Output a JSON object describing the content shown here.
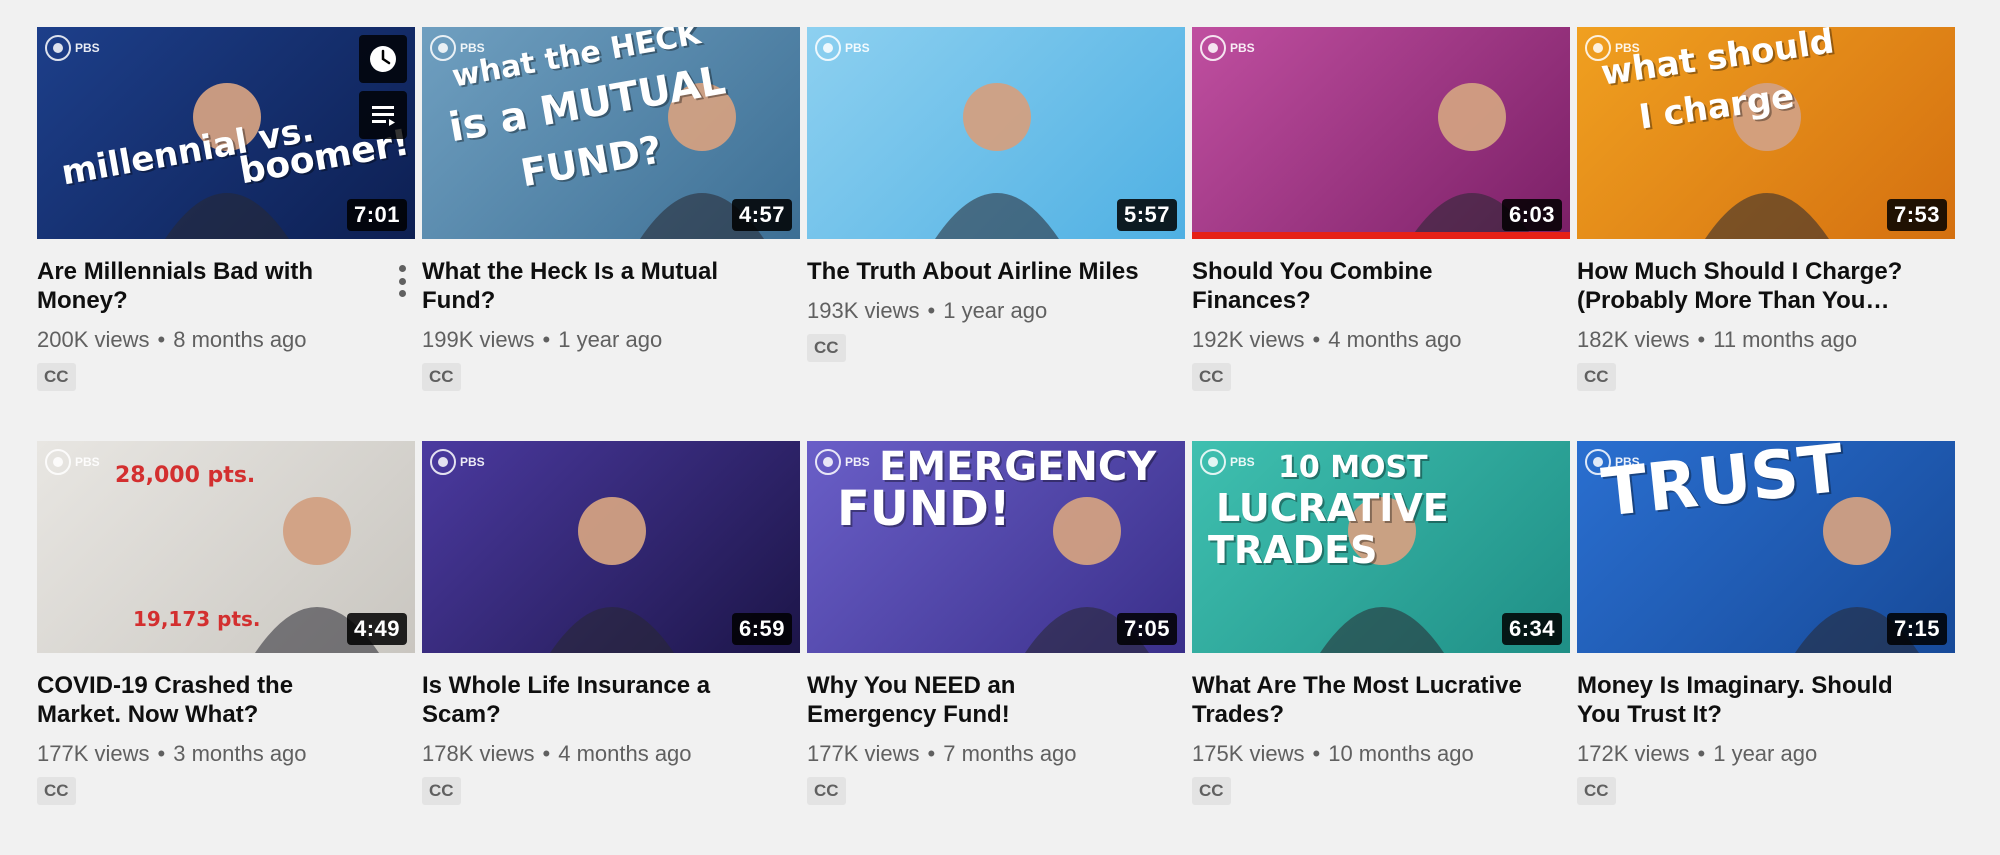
{
  "videos": [
    {
      "title": "Are Millennials Bad with Money?",
      "views": "200K views",
      "age": "8 months ago",
      "duration": "7:01",
      "cc": "CC",
      "thumb_text": [
        "millennial vs.",
        "boomer!"
      ],
      "bg": [
        "#1d3f8a",
        "#0d1f52"
      ],
      "show_menu": true,
      "progress": 0
    },
    {
      "title": "What the Heck Is a Mutual Fund?",
      "views": "199K views",
      "age": "1 year ago",
      "duration": "4:57",
      "cc": "CC",
      "thumb_text": [
        "what the HECK",
        "is a MUTUAL",
        "FUND?"
      ],
      "bg": [
        "#6f9fc0",
        "#3d6f94"
      ],
      "progress": 0
    },
    {
      "title": "The Truth About Airline Miles",
      "views": "193K views",
      "age": "1 year ago",
      "duration": "5:57",
      "cc": "CC",
      "thumb_text": [],
      "bg": [
        "#8dd0f0",
        "#4fb0e3"
      ],
      "progress": 0
    },
    {
      "title": "Should You Combine Finances?",
      "views": "192K views",
      "age": "4 months ago",
      "duration": "6:03",
      "cc": "CC",
      "thumb_text": [],
      "bg": [
        "#c04fa0",
        "#7a1f66"
      ],
      "progress": 1.0
    },
    {
      "title": "How Much Should I Charge? (Probably More Than You…",
      "views": "182K views",
      "age": "11 months ago",
      "duration": "7:53",
      "cc": "CC",
      "thumb_text": [
        "what should",
        "I charge"
      ],
      "bg": [
        "#f0a020",
        "#d47010"
      ],
      "progress": 0
    },
    {
      "title": "COVID-19 Crashed the Market. Now What?",
      "views": "177K views",
      "age": "3 months ago",
      "duration": "4:49",
      "cc": "CC",
      "thumb_text": [
        "28,000 pts.",
        "19,173 pts."
      ],
      "bg": [
        "#e8e6e2",
        "#c9c6c0"
      ],
      "progress": 0
    },
    {
      "title": "Is Whole Life Insurance a Scam?",
      "views": "178K views",
      "age": "4 months ago",
      "duration": "6:59",
      "cc": "CC",
      "thumb_text": [],
      "bg": [
        "#4b3aa0",
        "#1c1548"
      ],
      "progress": 0
    },
    {
      "title": "Why You NEED an Emergency Fund!",
      "views": "177K views",
      "age": "7 months ago",
      "duration": "7:05",
      "cc": "CC",
      "thumb_text": [
        "EMERGENCY",
        "FUND!"
      ],
      "bg": [
        "#6a5fc8",
        "#3a2f8a"
      ],
      "progress": 0
    },
    {
      "title": "What Are The Most Lucrative Trades?",
      "views": "175K views",
      "age": "10 months ago",
      "duration": "6:34",
      "cc": "CC",
      "thumb_text": [
        "10 MOST",
        "LUCRATIVE",
        "TRADES"
      ],
      "bg": [
        "#3fc0b0",
        "#1f8f86"
      ],
      "progress": 0
    },
    {
      "title": "Money Is Imaginary. Should You Trust It?",
      "views": "172K views",
      "age": "1 year ago",
      "duration": "7:15",
      "cc": "CC",
      "thumb_text": [
        "TRUST"
      ],
      "bg": [
        "#2a6fd0",
        "#174a99"
      ],
      "progress": 0
    }
  ],
  "pbs_label": "PBS",
  "hover_buttons": {
    "watch_later_icon": "clock-icon",
    "add_to_queue_icon": "queue-icon"
  }
}
